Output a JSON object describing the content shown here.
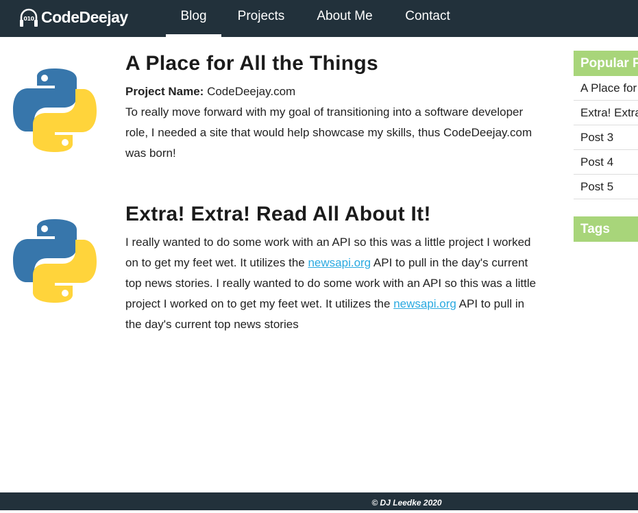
{
  "brand": {
    "name": "CodeDeejay",
    "logo_text": "010"
  },
  "nav": {
    "items": [
      {
        "label": "Blog",
        "active": true
      },
      {
        "label": "Projects"
      },
      {
        "label": "About Me"
      },
      {
        "label": "Contact"
      }
    ]
  },
  "posts": [
    {
      "title": "A Place for All the Things",
      "project_label": "Project Name:",
      "project_value": "CodeDeejay.com",
      "body": "To really move forward with my goal of transitioning into a software developer role, I needed a site that would help showcase my skills, thus CodeDeejay.com was born!"
    },
    {
      "title": "Extra! Extra! Read All About It!",
      "p1": "I really wanted to do some work with an API so this was a little project I worked on to get my feet wet. It utilizes the ",
      "link1": "newsapi.org",
      "p2": " API to pull in the day's current top news stories. I really wanted to do some work with an API so this was a little project I worked on to get my feet wet. It utilizes the ",
      "link2": "newsapi.org",
      "p3": " API to pull in the day's current top news stories"
    }
  ],
  "sidebar": {
    "popular_title": "Popular Posts",
    "popular": [
      "A Place for All the Things",
      "Extra! Extra! Read All About It!",
      "Post 3",
      "Post 4",
      "Post 5"
    ],
    "tags_title": "Tags"
  },
  "footer": {
    "text": "© DJ Leedke 2020"
  },
  "colors": {
    "nav": "#22313b",
    "accent": "#a8d57a",
    "link": "#29a9e0"
  }
}
